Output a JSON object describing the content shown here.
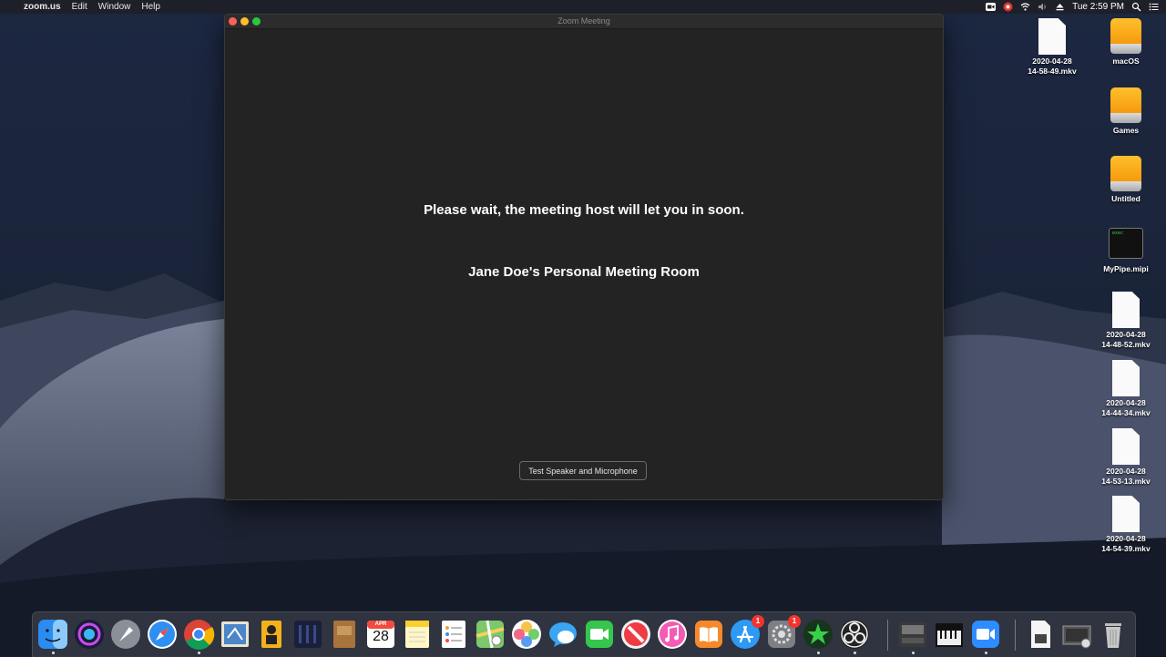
{
  "menubar": {
    "apple_glyph": "",
    "app_name": "zoom.us",
    "menus": [
      "Edit",
      "Window",
      "Help"
    ],
    "clock": "Tue 2:59 PM"
  },
  "window": {
    "title": "Zoom Meeting",
    "wait_message": "Please wait, the meeting host will let you in soon.",
    "room_name": "Jane Doe's Personal Meeting Room",
    "test_button": "Test Speaker and Microphone"
  },
  "desktop": {
    "icons": [
      {
        "label": "2020-04-28\n14-58-49.mkv",
        "kind": "document"
      },
      {
        "label": "macOS",
        "kind": "drive"
      },
      {
        "label": "Games",
        "kind": "drive"
      },
      {
        "label": "Untitled",
        "kind": "drive"
      },
      {
        "label": "MyPipe.mipi",
        "kind": "exec"
      },
      {
        "label": "2020-04-28\n14-48-52.mkv",
        "kind": "document"
      },
      {
        "label": "2020-04-28\n14-44-34.mkv",
        "kind": "document"
      },
      {
        "label": "2020-04-28\n14-53-13.mkv",
        "kind": "document"
      },
      {
        "label": "2020-04-28\n14-54-39.mkv",
        "kind": "document"
      }
    ],
    "exec_text": "exec"
  },
  "dock": {
    "calendar_month": "APR",
    "calendar_day": "28",
    "app_store_badge": "1",
    "system_prefs_badge": "1",
    "items": [
      "finder-icon",
      "siri-icon",
      "launchpad-icon",
      "safari-icon",
      "chrome-icon",
      "mail-icon",
      "portrait-app-icon",
      "audio-app-icon",
      "notebook-icon",
      "calendar-icon",
      "notes-icon",
      "reminders-icon",
      "maps-icon",
      "photos-icon",
      "messages-icon",
      "facetime-icon",
      "news-icon",
      "itunes-icon",
      "books-icon",
      "app-store-icon",
      "system-preferences-icon",
      "green-app-icon",
      "obs-icon",
      "zoom-recorder-icon",
      "piano-icon",
      "zoom-app-icon",
      "file-icon",
      "screenshot-icon",
      "trash-icon"
    ]
  },
  "colors": {
    "window_bg": "#232323",
    "close": "#fd5f57",
    "minimize": "#fdbc2e",
    "maximize": "#28c840",
    "zoom_blue": "#2d8cff",
    "drive_orange": "#f7a51c"
  }
}
